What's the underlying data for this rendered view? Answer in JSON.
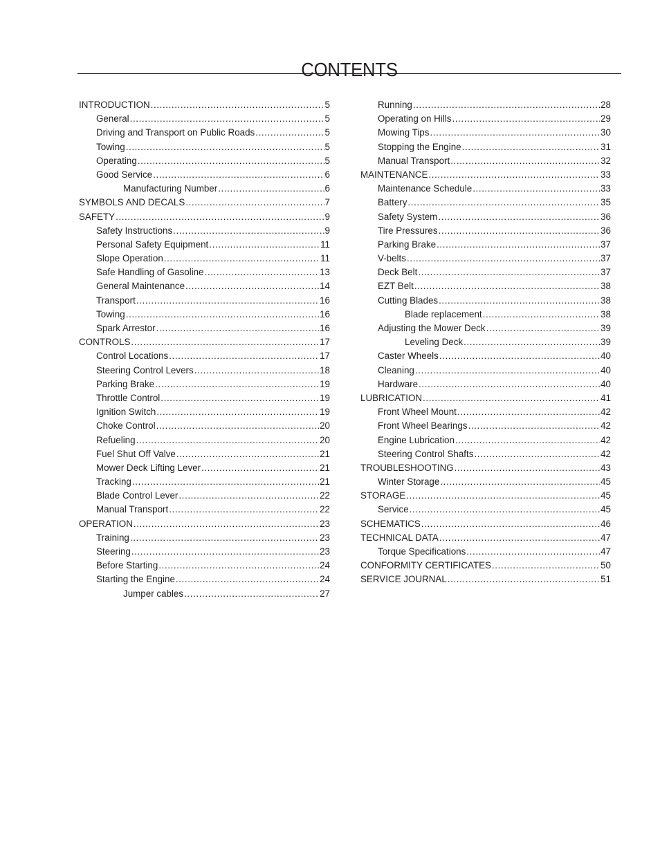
{
  "page": {
    "title": "CONTENTS"
  },
  "toc": {
    "left": [
      {
        "label": "INTRODUCTION",
        "page": "5",
        "level": 0
      },
      {
        "label": "General",
        "page": "5",
        "level": 1
      },
      {
        "label": "Driving and Transport on Public Roads",
        "page": "5",
        "level": 1
      },
      {
        "label": "Towing",
        "page": "5",
        "level": 1
      },
      {
        "label": "Operating",
        "page": "5",
        "level": 1
      },
      {
        "label": "Good Service",
        "page": "6",
        "level": 1
      },
      {
        "label": "Manufacturing Number",
        "page": "6",
        "level": 2
      },
      {
        "label": "SYMBOLS AND DECALS",
        "page": "7",
        "level": 0
      },
      {
        "label": "SAFETY",
        "page": "9",
        "level": 0
      },
      {
        "label": "Safety Instructions",
        "page": "9",
        "level": 1
      },
      {
        "label": "Personal Safety Equipment",
        "page": "11",
        "level": 1
      },
      {
        "label": "Slope Operation",
        "page": "11",
        "level": 1
      },
      {
        "label": "Safe Handling of Gasoline",
        "page": "13",
        "level": 1
      },
      {
        "label": "General Maintenance",
        "page": "14",
        "level": 1
      },
      {
        "label": "Transport",
        "page": "16",
        "level": 1
      },
      {
        "label": "Towing",
        "page": "16",
        "level": 1
      },
      {
        "label": "Spark Arrestor",
        "page": "16",
        "level": 1
      },
      {
        "label": "CONTROLS",
        "page": "17",
        "level": 0
      },
      {
        "label": "Control Locations",
        "page": "17",
        "level": 1
      },
      {
        "label": "Steering Control Levers",
        "page": "18",
        "level": 1
      },
      {
        "label": "Parking Brake",
        "page": "19",
        "level": 1
      },
      {
        "label": "Throttle Control",
        "page": "19",
        "level": 1
      },
      {
        "label": "Ignition Switch",
        "page": "19",
        "level": 1
      },
      {
        "label": "Choke Control",
        "page": "20",
        "level": 1
      },
      {
        "label": "Refueling",
        "page": "20",
        "level": 1
      },
      {
        "label": "Fuel Shut Off Valve",
        "page": "21",
        "level": 1
      },
      {
        "label": "Mower Deck Lifting Lever",
        "page": "21",
        "level": 1
      },
      {
        "label": "Tracking",
        "page": "21",
        "level": 1
      },
      {
        "label": "Blade Control Lever",
        "page": "22",
        "level": 1
      },
      {
        "label": "Manual Transport",
        "page": "22",
        "level": 1
      },
      {
        "label": "OPERATION",
        "page": "23",
        "level": 0
      },
      {
        "label": "Training",
        "page": "23",
        "level": 1
      },
      {
        "label": "Steering",
        "page": "23",
        "level": 1
      },
      {
        "label": "Before Starting",
        "page": "24",
        "level": 1
      },
      {
        "label": "Starting the Engine",
        "page": "24",
        "level": 1
      },
      {
        "label": "Jumper cables",
        "page": "27",
        "level": 2
      }
    ],
    "right": [
      {
        "label": "Running",
        "page": "28",
        "level": 1
      },
      {
        "label": "Operating on Hills",
        "page": "29",
        "level": 1
      },
      {
        "label": "Mowing Tips",
        "page": "30",
        "level": 1
      },
      {
        "label": "Stopping the Engine",
        "page": "31",
        "level": 1
      },
      {
        "label": "Manual Transport",
        "page": "32",
        "level": 1
      },
      {
        "label": "MAINTENANCE",
        "page": "33",
        "level": 0
      },
      {
        "label": "Maintenance Schedule",
        "page": "33",
        "level": 1
      },
      {
        "label": "Battery",
        "page": "35",
        "level": 1
      },
      {
        "label": "Safety System",
        "page": "36",
        "level": 1
      },
      {
        "label": "Tire Pressures",
        "page": "36",
        "level": 1
      },
      {
        "label": "Parking Brake",
        "page": "37",
        "level": 1
      },
      {
        "label": "V-belts",
        "page": "37",
        "level": 1
      },
      {
        "label": "Deck Belt",
        "page": "37",
        "level": 1
      },
      {
        "label": "EZT Belt",
        "page": "38",
        "level": 1
      },
      {
        "label": "Cutting Blades",
        "page": "38",
        "level": 1
      },
      {
        "label": "Blade replacement",
        "page": "38",
        "level": 2
      },
      {
        "label": "Adjusting the Mower Deck",
        "page": "39",
        "level": 1
      },
      {
        "label": "Leveling Deck",
        "page": "39",
        "level": 2
      },
      {
        "label": "Caster Wheels",
        "page": "40",
        "level": 1
      },
      {
        "label": "Cleaning",
        "page": "40",
        "level": 1
      },
      {
        "label": "Hardware",
        "page": "40",
        "level": 1
      },
      {
        "label": "LUBRICATION",
        "page": "41",
        "level": 0
      },
      {
        "label": "Front Wheel Mount",
        "page": "42",
        "level": 1
      },
      {
        "label": "Front Wheel Bearings",
        "page": "42",
        "level": 1
      },
      {
        "label": "Engine Lubrication",
        "page": "42",
        "level": 1
      },
      {
        "label": "Steering Control Shafts",
        "page": "42",
        "level": 1
      },
      {
        "label": "TROUBLESHOOTING",
        "page": "43",
        "level": 0
      },
      {
        "label": "Winter Storage",
        "page": "45",
        "level": 1
      },
      {
        "label": "STORAGE",
        "page": "45",
        "level": 0
      },
      {
        "label": "Service",
        "page": "45",
        "level": 1
      },
      {
        "label": "SCHEMATICS",
        "page": "46",
        "level": 0
      },
      {
        "label": "TECHNICAL DATA",
        "page": "47",
        "level": 0
      },
      {
        "label": "Torque Specifications",
        "page": "47",
        "level": 1
      },
      {
        "label": "CONFORMITY CERTIFICATES",
        "page": "50",
        "level": 0
      },
      {
        "label": "SERVICE JOURNAL",
        "page": "51",
        "level": 0
      }
    ]
  }
}
